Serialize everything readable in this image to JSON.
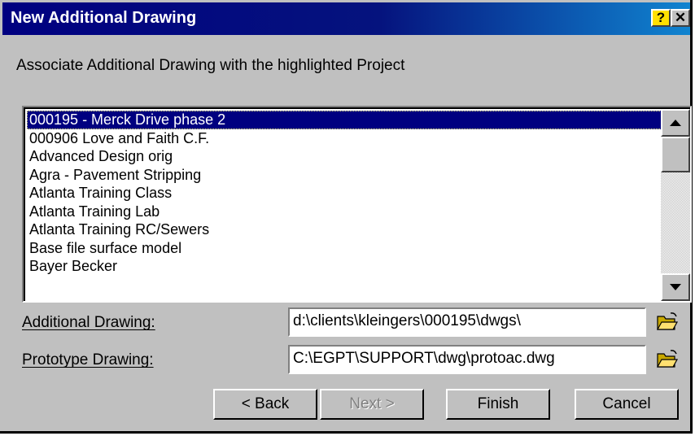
{
  "dialog": {
    "title": "New Additional Drawing",
    "help_glyph": "?",
    "close_glyph": "✕"
  },
  "prompt": "Associate Additional Drawing with the highlighted Project",
  "projects": {
    "items": [
      "000195 - Merck Drive phase 2",
      "000906 Love and Faith C.F.",
      "Advanced Design orig",
      "Agra - Pavement Stripping",
      "Atlanta Training Class",
      "Atlanta Training Lab",
      "Atlanta Training RC/Sewers",
      "Base file surface model",
      "Bayer Becker"
    ],
    "selected_index": 0
  },
  "fields": {
    "additional_label": "Additional Drawing:",
    "additional_value": "d:\\clients\\kleingers\\000195\\dwgs\\",
    "prototype_label": "Prototype Drawing:",
    "prototype_value": "C:\\EGPT\\SUPPORT\\dwg\\protoac.dwg"
  },
  "buttons": {
    "back": "< Back",
    "next": "Next >",
    "finish": "Finish",
    "cancel": "Cancel"
  },
  "icons": {
    "folder": "open-folder-icon",
    "scroll_up": "triangle-up-icon",
    "scroll_down": "triangle-down-icon"
  },
  "colors": {
    "title_bar": "#000080",
    "selection": "#000080",
    "face": "#c0c0c0"
  }
}
